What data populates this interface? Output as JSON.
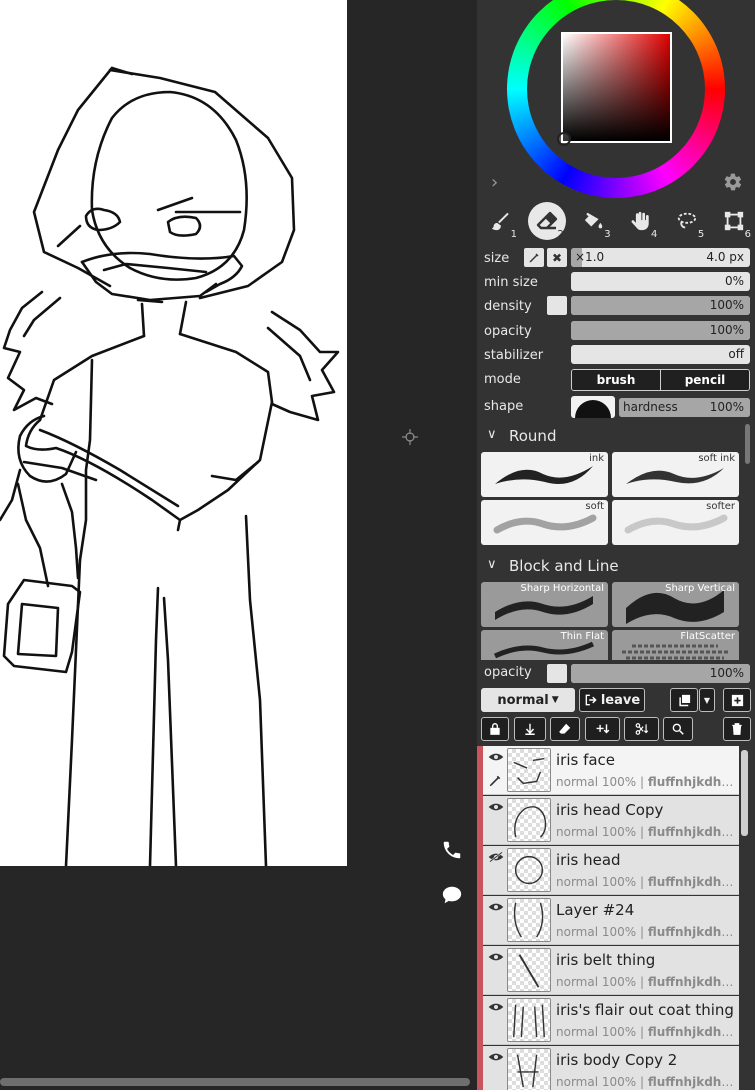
{
  "tools": [
    {
      "name": "brush",
      "number": "1"
    },
    {
      "name": "eraser",
      "number": "2"
    },
    {
      "name": "fill",
      "number": "3"
    },
    {
      "name": "hand",
      "number": "4"
    },
    {
      "name": "lasso-select",
      "number": "5"
    },
    {
      "name": "transform",
      "number": "6"
    }
  ],
  "brush_settings": {
    "size_label": "size",
    "size_multiplier": "×1.0",
    "size_value": "4.0 px",
    "min_size_label": "min size",
    "min_size_value": "0%",
    "density_label": "density",
    "density_value": "100%",
    "opacity_label": "opacity",
    "opacity_value": "100%",
    "stabilizer_label": "stabilizer",
    "stabilizer_value": "off",
    "mode_label": "mode",
    "mode_brush": "brush",
    "mode_pencil": "pencil",
    "shape_label": "shape",
    "hardness_label": "hardness",
    "hardness_value": "100%"
  },
  "brush_library": {
    "categories": [
      {
        "name": "Round",
        "presets": [
          "ink",
          "soft ink",
          "soft",
          "softer"
        ]
      },
      {
        "name": "Block and Line",
        "presets": [
          "Sharp Horizontal",
          "Sharp Vertical",
          "Thin Flat",
          "FlatScatter"
        ]
      }
    ]
  },
  "layer_panel": {
    "opacity_label": "opacity",
    "opacity_value": "100%",
    "blend_mode": "normal",
    "leave_label": "leave"
  },
  "layers": [
    {
      "name": "iris face",
      "mode": "normal",
      "opacity": "100%",
      "owner": "fluffnhjkdh...",
      "visible": true,
      "active": true
    },
    {
      "name": "iris head Copy",
      "mode": "normal",
      "opacity": "100%",
      "owner": "fluffnhjkdh...",
      "visible": true,
      "active": false
    },
    {
      "name": "iris head",
      "mode": "normal",
      "opacity": "100%",
      "owner": "fluffnhjkdh...",
      "visible": false,
      "active": false
    },
    {
      "name": "Layer #24",
      "mode": "normal",
      "opacity": "100%",
      "owner": "fluffnhjkdh...",
      "visible": true,
      "active": false
    },
    {
      "name": "iris belt thing",
      "mode": "normal",
      "opacity": "100%",
      "owner": "fluffnhjkdh...",
      "visible": true,
      "active": false
    },
    {
      "name": "iris's flair out coat thing",
      "mode": "normal",
      "opacity": "100%",
      "owner": "fluffnhjkdh...",
      "visible": true,
      "active": false
    },
    {
      "name": "iris body Copy 2",
      "mode": "normal",
      "opacity": "100%",
      "owner": "fluffnhjkdh...",
      "visible": true,
      "active": false
    }
  ],
  "colors": {
    "panel_bg": "#333333",
    "canvas_bg": "#262626",
    "active_layer_bar": "#c9545c",
    "current_color": "#000000"
  }
}
